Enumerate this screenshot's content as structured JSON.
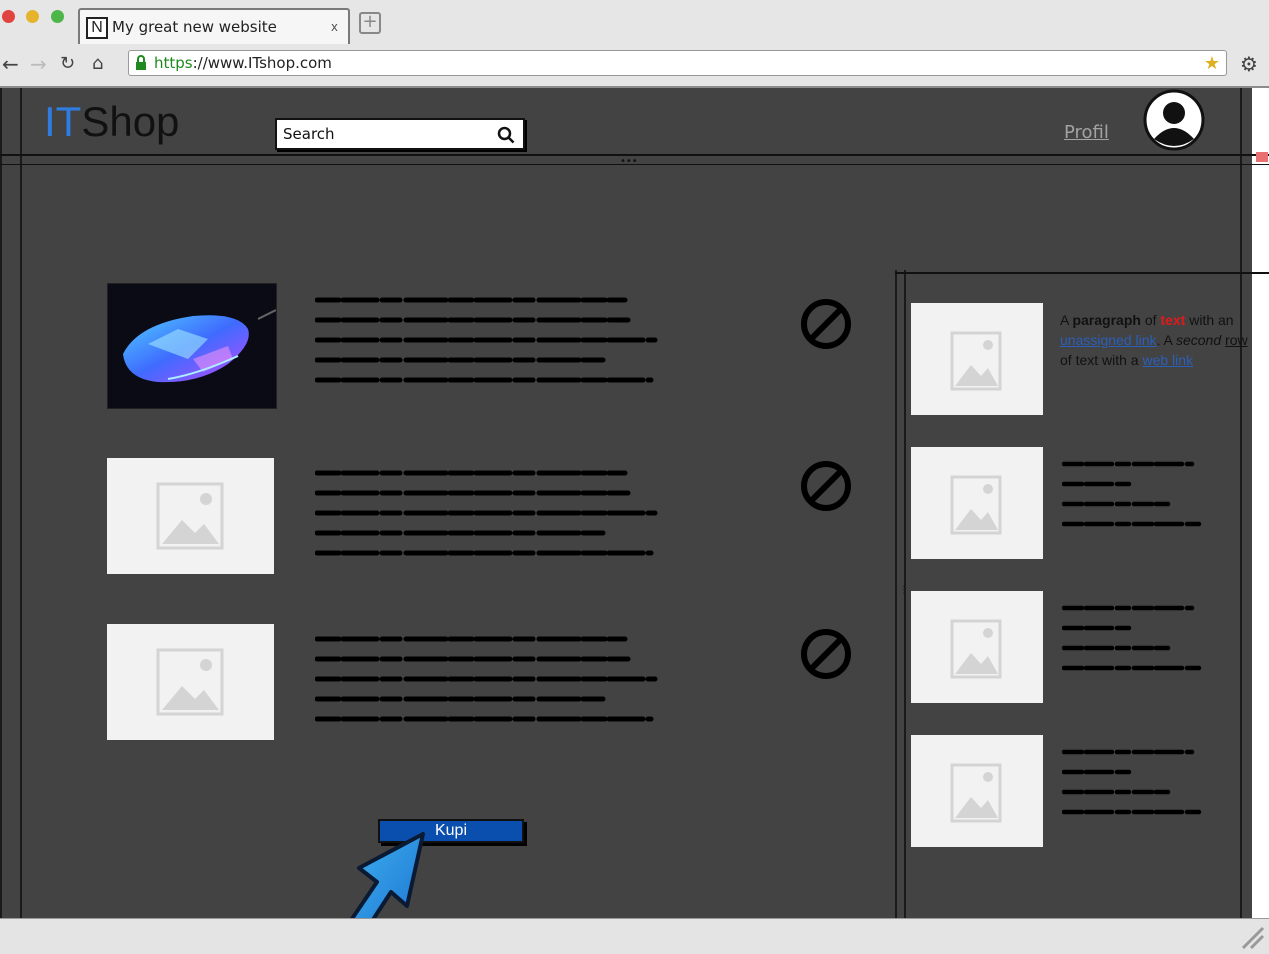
{
  "browser": {
    "tab_title": "My great new website",
    "tab_favicon": "N",
    "tab_close": "x",
    "new_tab": "+",
    "url_protocol": "https",
    "url_rest": "://www.ITshop.com"
  },
  "header": {
    "logo_it": "IT",
    "logo_shop": "Shop",
    "search_placeholder": "Search",
    "profile_link": "Profil"
  },
  "products": [
    {
      "image": "mouse-photo",
      "status_icon": "blocked-icon"
    },
    {
      "image": "image-placeholder",
      "status_icon": "blocked-icon"
    },
    {
      "image": "image-placeholder",
      "status_icon": "blocked-icon"
    }
  ],
  "sidebar": {
    "paragraph": {
      "t1": "A ",
      "t2": "paragraph",
      "t3": " of ",
      "t4": "text",
      "t5": " with an ",
      "t6": "unassigned link",
      "t7": ". A ",
      "t8": "second",
      "t9": " ",
      "t10": "row",
      "t11": " of text with a ",
      "t12": "web link"
    }
  },
  "buy_button": "Kupi",
  "colors": {
    "accent": "#2f7de1",
    "page_bg": "#434343",
    "button": "#0b4fae",
    "link": "#2b5fb8",
    "highlight": "#e01a1a"
  }
}
